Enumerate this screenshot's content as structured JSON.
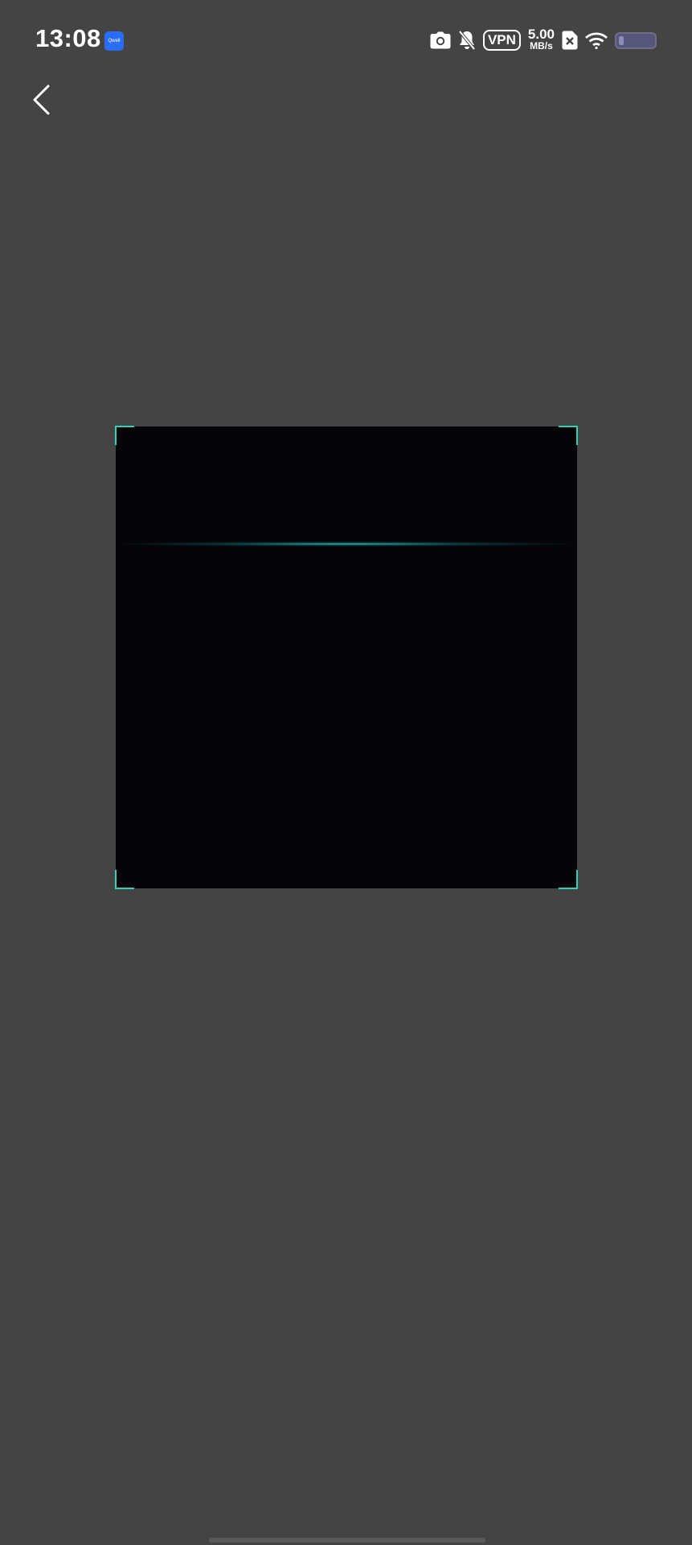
{
  "status_bar": {
    "time": "13:08",
    "notification_app_label": "Qwell",
    "vpn_label": "VPN",
    "net_speed_value": "5.00",
    "net_speed_unit": "MB/s",
    "battery_level_fraction": 0.15,
    "icons": [
      "camera-icon",
      "bell-muted-icon",
      "vpn-icon",
      "sim-off-icon",
      "wifi-icon",
      "battery-icon"
    ]
  },
  "nav": {
    "back_icon": "chevron-left-icon"
  },
  "scanner": {
    "accent_color": "#2fd3b8",
    "frame_background": "#050408"
  },
  "colors": {
    "overlay_background": "#444444"
  }
}
